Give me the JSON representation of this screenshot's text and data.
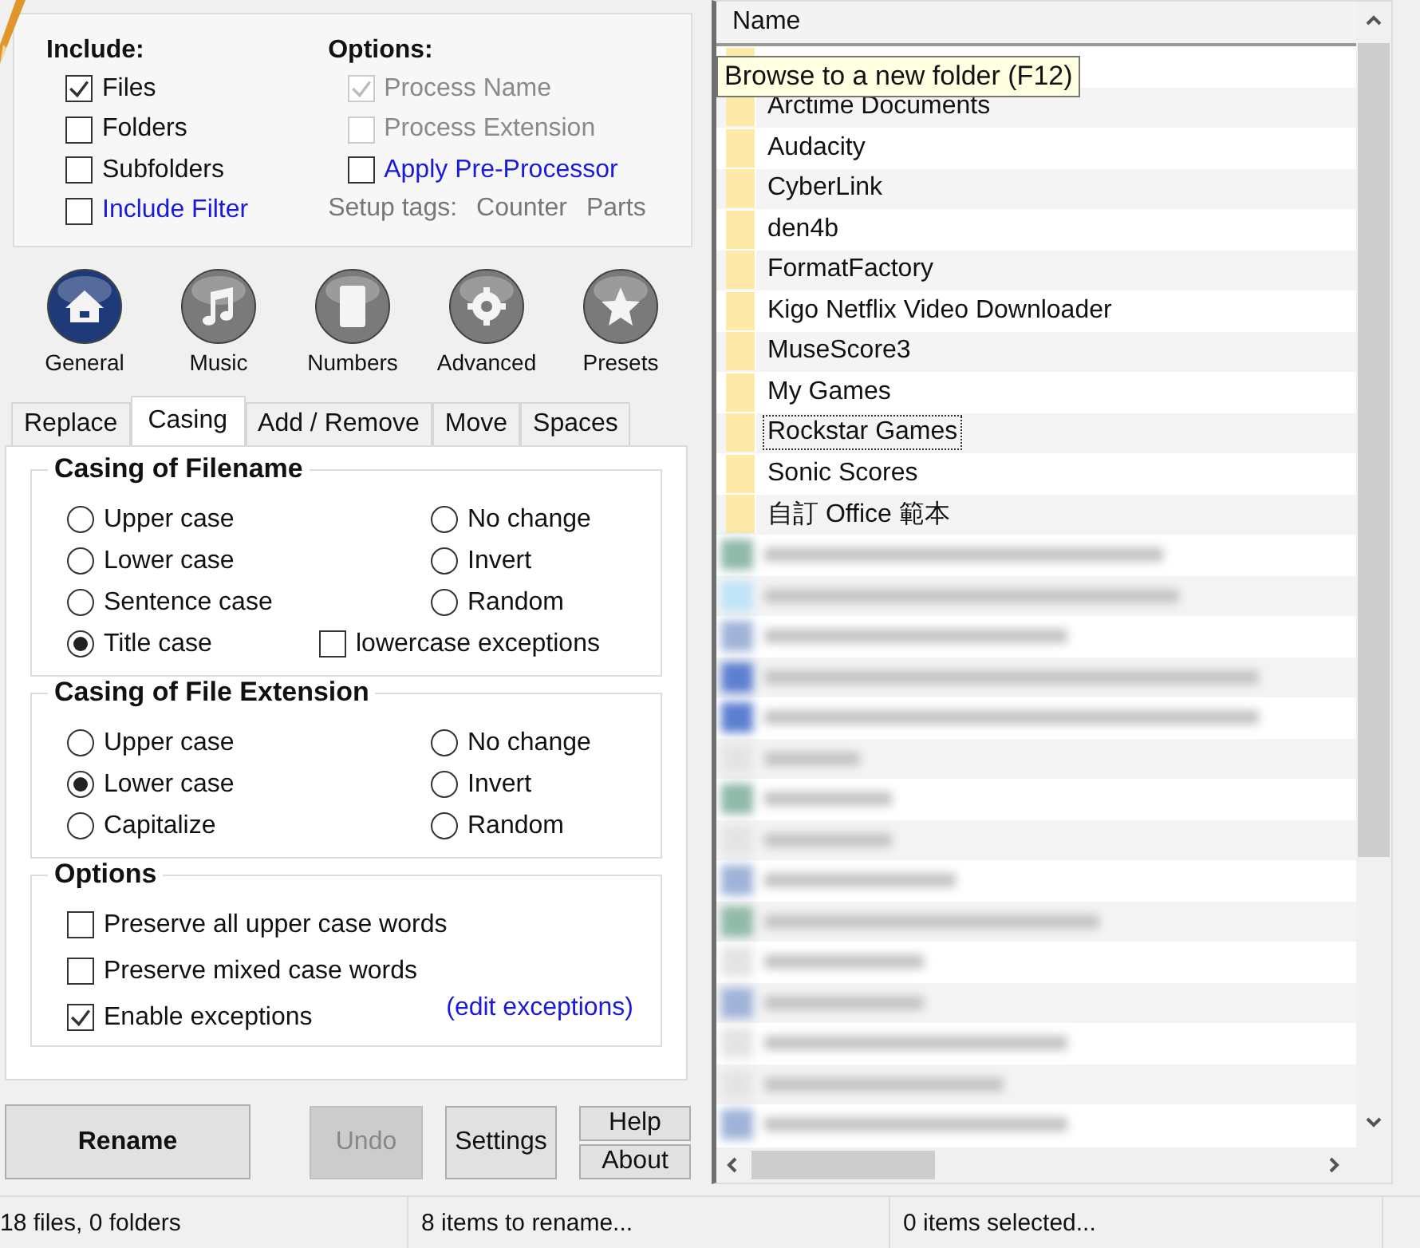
{
  "include": {
    "title": "Include:",
    "items": [
      {
        "label": "Files",
        "checked": true,
        "link": false
      },
      {
        "label": "Folders",
        "checked": false,
        "link": false
      },
      {
        "label": "Subfolders",
        "checked": false,
        "link": false
      },
      {
        "label": "Include Filter",
        "checked": false,
        "link": true
      }
    ]
  },
  "options": {
    "title": "Options:",
    "items": [
      {
        "label": "Process Name",
        "checked": true,
        "disabled": true,
        "link": false
      },
      {
        "label": "Process Extension",
        "checked": false,
        "disabled": true,
        "link": false
      },
      {
        "label": "Apply Pre-Processor",
        "checked": false,
        "disabled": false,
        "link": true
      }
    ],
    "setup_tags": [
      "Setup tags:",
      "Counter",
      "Parts"
    ]
  },
  "modes": [
    {
      "kind": "general",
      "label": "General",
      "selected": true
    },
    {
      "kind": "music",
      "label": "Music",
      "selected": false
    },
    {
      "kind": "numbers",
      "label": "Numbers",
      "selected": false
    },
    {
      "kind": "advanced",
      "label": "Advanced",
      "selected": false
    },
    {
      "kind": "presets",
      "label": "Presets",
      "selected": false
    }
  ],
  "tabs": [
    {
      "label": "Replace",
      "selected": false
    },
    {
      "label": "Casing",
      "selected": true
    },
    {
      "label": "Add / Remove",
      "selected": false
    },
    {
      "label": "Move",
      "selected": false
    },
    {
      "label": "Spaces",
      "selected": false
    }
  ],
  "groups": [
    {
      "title": "Casing of Filename",
      "items": [
        {
          "kind": "radio",
          "label": "Upper case",
          "selected": false
        },
        {
          "kind": "radio",
          "label": "Lower case",
          "selected": false
        },
        {
          "kind": "radio",
          "label": "Sentence case",
          "selected": false
        },
        {
          "kind": "radio",
          "label": "Title case",
          "selected": true
        },
        {
          "kind": "radio",
          "label": "No change",
          "selected": false
        },
        {
          "kind": "radio",
          "label": "Invert",
          "selected": false
        },
        {
          "kind": "radio",
          "label": "Random",
          "selected": false
        },
        {
          "kind": "checkbox",
          "label": "lowercase exceptions",
          "checked": false
        }
      ]
    },
    {
      "title": "Casing of File Extension",
      "items": [
        {
          "kind": "radio",
          "label": "Upper case",
          "selected": false
        },
        {
          "kind": "radio",
          "label": "Lower case",
          "selected": true
        },
        {
          "kind": "radio",
          "label": "Capitalize",
          "selected": false
        },
        {
          "kind": "radio",
          "label": "No change",
          "selected": false
        },
        {
          "kind": "radio",
          "label": "Invert",
          "selected": false
        },
        {
          "kind": "radio",
          "label": "Random",
          "selected": false
        }
      ]
    }
  ],
  "case_options": {
    "title": "Options",
    "items": [
      {
        "label": "Preserve all upper case words",
        "checked": false
      },
      {
        "label": "Preserve mixed case words",
        "checked": false
      },
      {
        "label": "Enable exceptions",
        "checked": true
      }
    ],
    "link": "(edit exceptions)"
  },
  "buttons": {
    "rename": "Rename",
    "undo": {
      "label": "Undo",
      "disabled": true
    },
    "settings": "Settings",
    "help": "Help",
    "about": "About"
  },
  "file_list": {
    "column": "Name",
    "tooltip": "Browse to a new folder (F12)",
    "rows": [
      {
        "name": "Arctime Documents",
        "focused": false
      },
      {
        "name": "Audacity",
        "focused": false
      },
      {
        "name": "CyberLink",
        "focused": false
      },
      {
        "name": "den4b",
        "focused": false
      },
      {
        "name": "FormatFactory",
        "focused": false
      },
      {
        "name": "Kigo Netflix Video Downloader",
        "focused": false
      },
      {
        "name": "MuseScore3",
        "focused": false
      },
      {
        "name": "My Games",
        "focused": false
      },
      {
        "name": "Rockstar Games",
        "focused": true
      },
      {
        "name": "Sonic Scores",
        "focused": false
      },
      {
        "name": "自訂 Office 範本",
        "focused": false
      }
    ]
  },
  "status_bar": [
    "18 files, 0 folders",
    "8 items to rename...",
    "0 items selected..."
  ]
}
